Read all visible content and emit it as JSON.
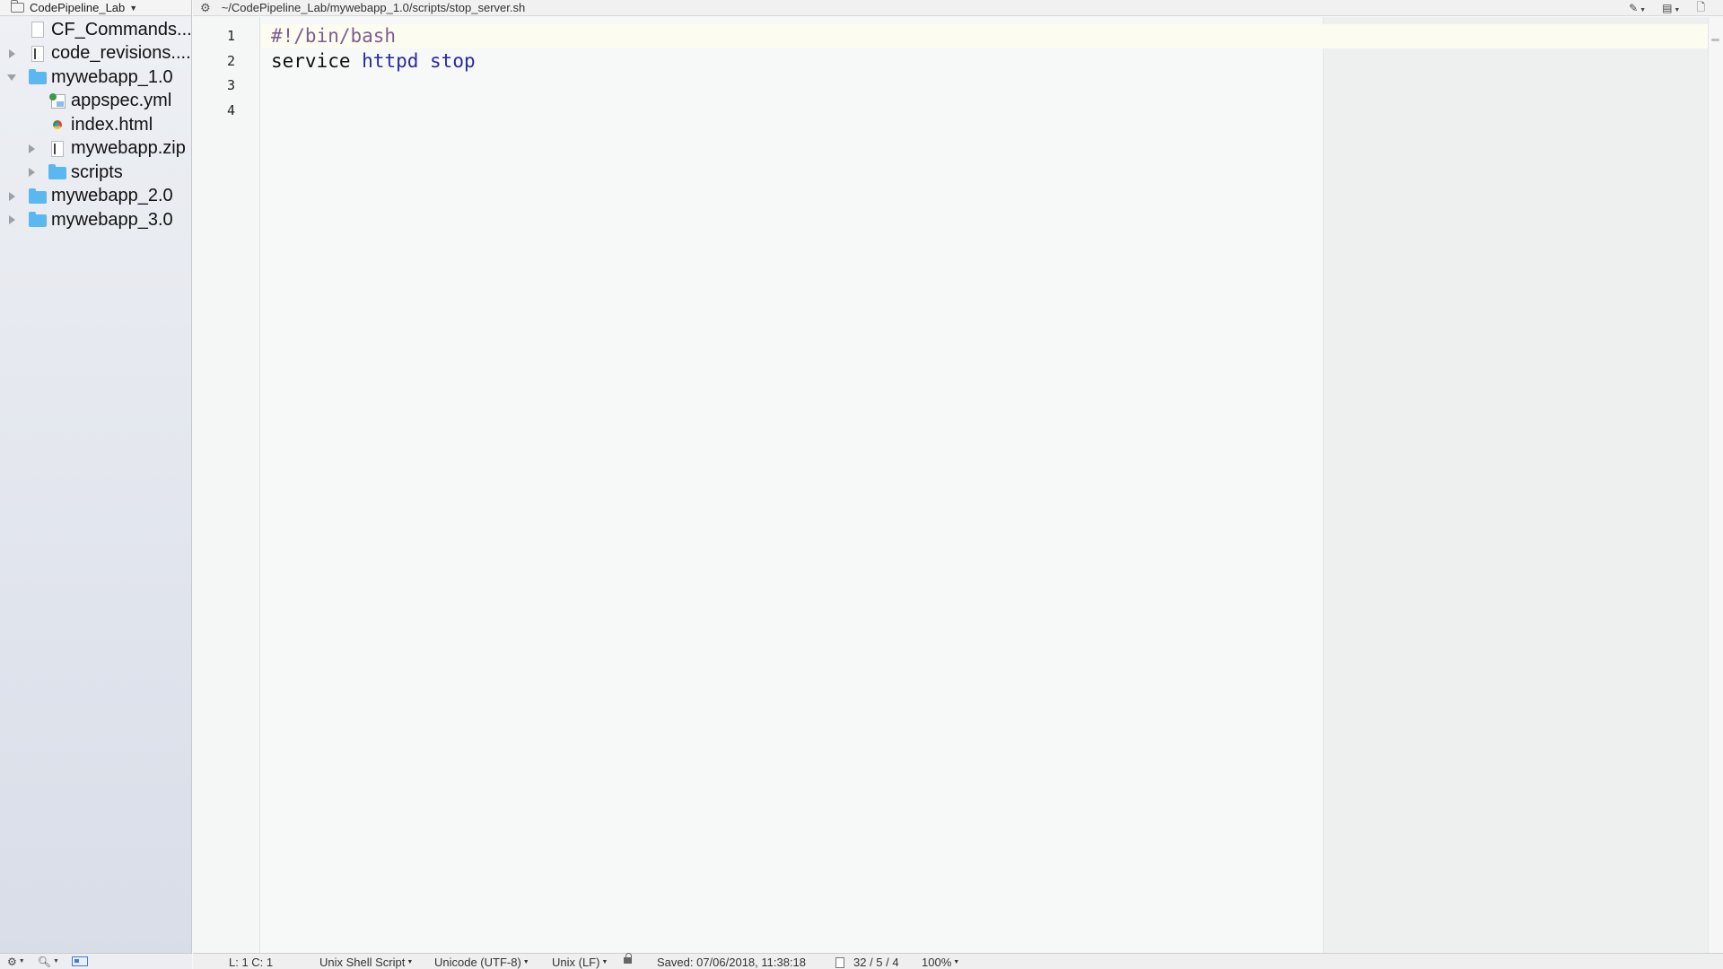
{
  "project": {
    "name": "CodePipeline_Lab"
  },
  "tree": [
    {
      "label": "CF_Commands....",
      "icon": "doc",
      "depth": 0,
      "disclosure": "none"
    },
    {
      "label": "code_revisions....",
      "icon": "doc-ruled",
      "depth": 0,
      "disclosure": "closed"
    },
    {
      "label": "mywebapp_1.0",
      "icon": "folder",
      "depth": 0,
      "disclosure": "open"
    },
    {
      "label": "appspec.yml",
      "icon": "yml",
      "depth": 1,
      "disclosure": "none"
    },
    {
      "label": "index.html",
      "icon": "html",
      "depth": 1,
      "disclosure": "none"
    },
    {
      "label": "mywebapp.zip",
      "icon": "doc-ruled",
      "depth": 1,
      "disclosure": "closed"
    },
    {
      "label": "scripts",
      "icon": "folder",
      "depth": 1,
      "disclosure": "closed"
    },
    {
      "label": "mywebapp_2.0",
      "icon": "folder",
      "depth": 0,
      "disclosure": "closed"
    },
    {
      "label": "mywebapp_3.0",
      "icon": "folder",
      "depth": 0,
      "disclosure": "closed"
    }
  ],
  "editor": {
    "path": "~/CodePipeline_Lab/mywebapp_1.0/scripts/stop_server.sh",
    "line_numbers": [
      "1",
      "2",
      "3",
      "4"
    ],
    "lines": [
      [
        {
          "text": "#!/bin/bash",
          "kind": "comment"
        }
      ],
      [
        {
          "text": "service ",
          "kind": "plain"
        },
        {
          "text": "httpd",
          "kind": "kw"
        },
        {
          "text": " ",
          "kind": "plain"
        },
        {
          "text": "stop",
          "kind": "kw"
        }
      ]
    ]
  },
  "status": {
    "position": "L: 1 C: 1",
    "language": "Unix Shell Script",
    "encoding": "Unicode (UTF-8)",
    "line_endings": "Unix (LF)",
    "saved": "Saved: 07/06/2018, 11:38:18",
    "counts": "32 / 5 / 4",
    "zoom": "100%"
  },
  "colors": {
    "folder": "#5bb7ef",
    "comment": "#7d5e90",
    "keyword": "#2929a6"
  }
}
